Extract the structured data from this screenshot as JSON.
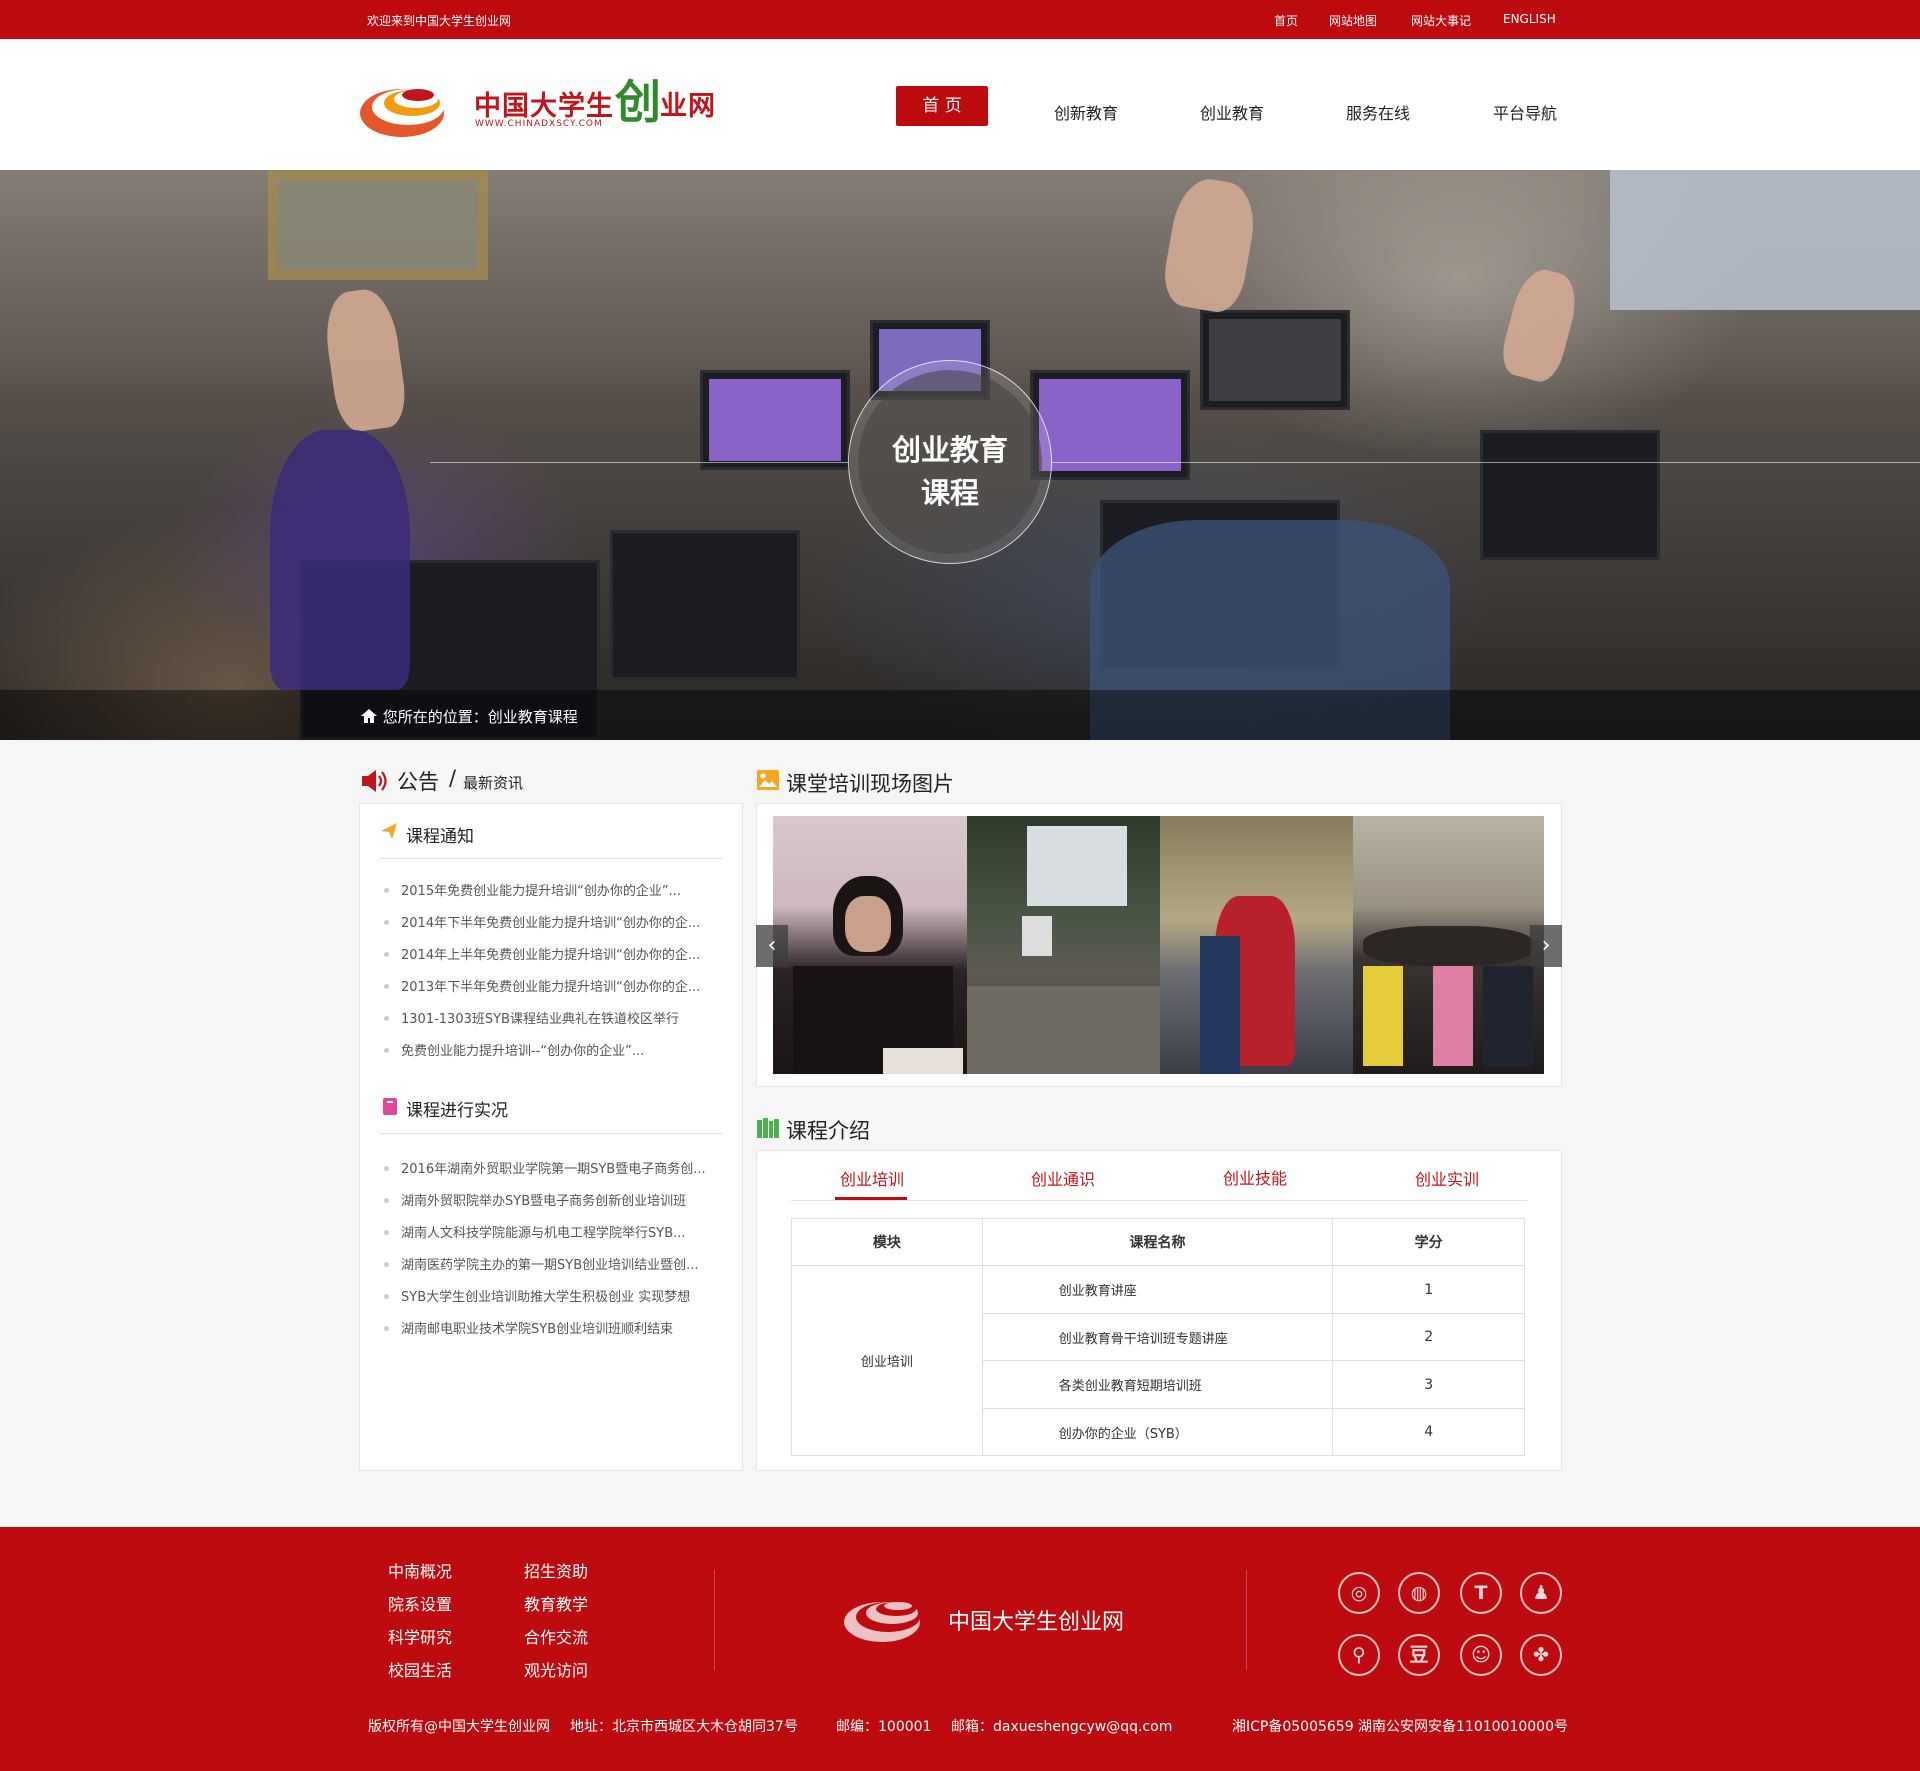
{
  "topbar": {
    "welcome": "欢迎来到中国大学生创业网",
    "links": [
      "首页",
      "网站地图",
      "网站大事记",
      "ENGLISH"
    ]
  },
  "header": {
    "logo_title": "中国大学生",
    "logo_chuang": "创",
    "logo_tail": "业网",
    "logo_url": "WWW.CHINADXSCY.COM",
    "nav": [
      "首 页",
      "创新教育",
      "创业教育",
      "服务在线",
      "平台导航"
    ]
  },
  "banner": {
    "title_line1": "创业教育",
    "title_line2": "课程",
    "breadcrumb_label": "您所在的位置：",
    "breadcrumb_current": "创业教育课程"
  },
  "notice": {
    "title": "公告",
    "slash": "/",
    "subtitle": "最新资讯",
    "box1_title": "课程通知",
    "box1_items": [
      "2015年免费创业能力提升培训“创办你的企业”...",
      "2014年下半年免费创业能力提升培训“创办你的企...",
      "2014年上半年免费创业能力提升培训“创办你的企...",
      "2013年下半年免费创业能力提升培训“创办你的企...",
      "1301-1303班SYB课程结业典礼在铁道校区举行",
      "免费创业能力提升培训--“创办你的企业”..."
    ],
    "box2_title": "课程进行实况",
    "box2_items": [
      "2016年湖南外贸职业学院第一期SYB暨电子商务创...",
      "湖南外贸职院举办SYB暨电子商务创新创业培训班",
      "湖南人文科技学院能源与机电工程学院举行SYB...",
      "湖南医药学院主办的第一期SYB创业培训结业暨创...",
      "SYB大学生创业培训助推大学生积极创业 实现梦想",
      "湖南邮电职业技术学院SYB创业培训班顺利结束"
    ]
  },
  "gallery": {
    "title": "课堂培训现场图片",
    "prev": "‹",
    "next": "›"
  },
  "course": {
    "title": "课程介绍",
    "tabs": [
      "创业培训",
      "创业通识",
      "创业技能",
      "创业实训"
    ],
    "headers": [
      "模块",
      "课程名称",
      "学分"
    ],
    "module": "创业培训",
    "rows": [
      {
        "name": "创业教育讲座",
        "credit": "1"
      },
      {
        "name": "创业教育骨干培训班专题讲座",
        "credit": "2"
      },
      {
        "name": "各类创业教育短期培训班",
        "credit": "3"
      },
      {
        "name": "创办你的企业（SYB）",
        "credit": "4"
      }
    ]
  },
  "footer": {
    "links_col1": [
      "中南概况",
      "院系设置",
      "科学研究",
      "校园生活"
    ],
    "links_col2": [
      "招生资助",
      "教育教学",
      "合作交流",
      "观光访问"
    ],
    "brand": "中国大学生创业网",
    "social_icons": [
      "weibo-icon",
      "wechat-icon",
      "tencent-weibo-icon",
      "qq-icon",
      "renren-icon",
      "douban-icon",
      "kaixin-icon",
      "clover-icon"
    ],
    "copyright": "版权所有@中国大学生创业网",
    "address": "地址：北京市西城区大木仓胡同37号",
    "postcode": "邮编：100001",
    "email": "邮箱：daxueshengcyw@qq.com",
    "icp": "湘ICP备05005659",
    "police": "湖南公安网安备11010010000号"
  },
  "colors": {
    "brand_red": "#bd0b10",
    "logo_green": "#2f8a2a",
    "icon_orange": "#f5a623",
    "icon_pink": "#e0489a",
    "icon_green": "#4caf50"
  }
}
